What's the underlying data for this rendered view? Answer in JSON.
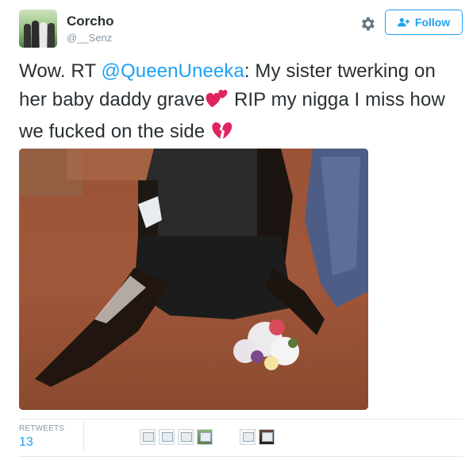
{
  "user": {
    "name": "Corcho",
    "handle": "@__Senz"
  },
  "actions": {
    "follow_label": "Follow",
    "settings_icon": "gear-icon"
  },
  "tweet": {
    "part1": "Wow. RT ",
    "mention": "@QueenUneeka",
    "part2": ": My sister twerking on her baby daddy grave",
    "part3": " RIP my nigga I miss how we fucked on the side ",
    "emoji1": "two-hearts-emoji",
    "emoji2": "broken-heart-emoji"
  },
  "stats": {
    "retweets_label": "RETWEETS",
    "retweets_count": "13"
  },
  "colors": {
    "accent": "#1da1f2",
    "text": "#292f33",
    "muted": "#8899a6",
    "heart": "#e0245e"
  }
}
